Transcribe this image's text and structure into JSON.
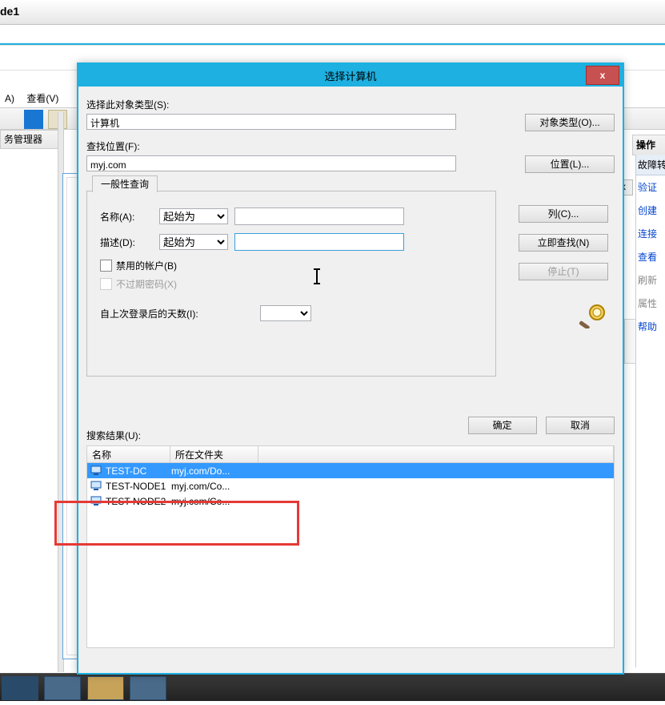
{
  "background": {
    "title": "de1",
    "menu_file": "A)",
    "menu_view": "查看(V)",
    "tree_header": "务管理器",
    "ops_header": "操作",
    "right_t1": "故障转",
    "right_close": "x",
    "right_links": [
      "验证",
      "创建",
      "连接",
      "查看",
      "刷新",
      "属性",
      "帮助"
    ]
  },
  "dialog": {
    "title": "选择计算机",
    "close": "x",
    "obj_type_label": "选择此对象类型(S):",
    "obj_type_value": "计算机",
    "obj_type_btn": "对象类型(O)...",
    "loc_label": "查找位置(F):",
    "loc_value": "myj.com",
    "loc_btn": "位置(L)...",
    "query_tab": "一般性查询",
    "name_label": "名称(A):",
    "desc_label": "描述(D):",
    "starts_with": "起始为",
    "disabled_acct": "禁用的帐户(B)",
    "no_expire": "不过期密码(X)",
    "days_label": "自上次登录后的天数(I):",
    "columns_btn": "列(C)...",
    "findnow_btn": "立即查找(N)",
    "stop_btn": "停止(T)",
    "ok_btn": "确定",
    "cancel_btn": "取消",
    "results_label": "搜索结果(U):",
    "col_name": "名称",
    "col_folder": "所在文件夹",
    "rows": [
      {
        "name": "TEST-DC",
        "folder": "myj.com/Do..."
      },
      {
        "name": "TEST-NODE1",
        "folder": "myj.com/Co..."
      },
      {
        "name": "TEST-NODE2",
        "folder": "myj.com/Co..."
      }
    ]
  }
}
